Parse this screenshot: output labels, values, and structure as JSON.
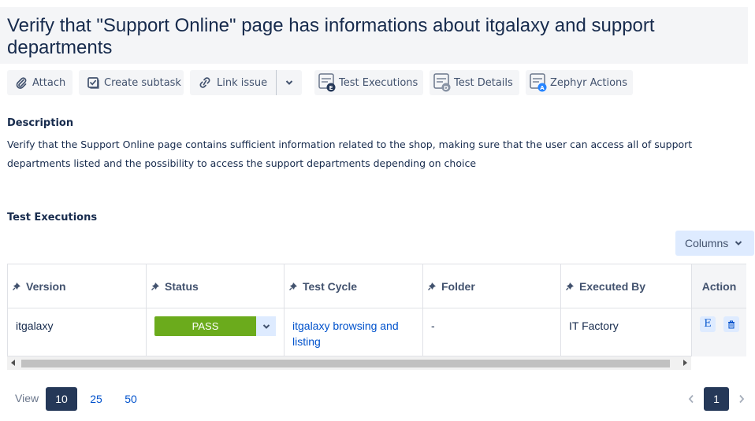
{
  "issue": {
    "title": "Verify that \"Support Online\" page has informations about itgalaxy and support departments"
  },
  "toolbar": {
    "attach_label": "Attach",
    "attach_icon": "paperclip-icon",
    "subtask_label": "Create subtask",
    "subtask_icon": "checkbox-icon",
    "link_label": "Link issue",
    "link_icon": "link-icon",
    "more_icon": "chevron-down-icon",
    "test_executions_label": "Test Executions",
    "test_details_label": "Test Details",
    "zephyr_actions_label": "Zephyr Actions"
  },
  "description": {
    "heading": "Description",
    "text": "Verify that the Support Online page contains sufficient information related to the shop, making sure that the user can access all of support departments listed and the possibility to access the support departments depending on choice"
  },
  "executions": {
    "heading": "Test Executions",
    "columns_button": "Columns",
    "headers": [
      "Version",
      "Status",
      "Test Cycle",
      "Folder",
      "Executed By",
      "Action"
    ],
    "rows": [
      {
        "version": "itgalaxy",
        "status": "PASS",
        "status_color": "#6bab1c",
        "test_cycle": "itgalaxy browsing and listing",
        "folder": "-",
        "executed_by": "IT Factory",
        "action_execute": "E"
      }
    ]
  },
  "pagination": {
    "view_label": "View",
    "page_sizes": [
      "10",
      "25",
      "50"
    ],
    "selected_page_size": "10",
    "current_page": "1"
  },
  "colors": {
    "accent": "#0052cc",
    "pass": "#6bab1c",
    "dark": "#253858"
  }
}
